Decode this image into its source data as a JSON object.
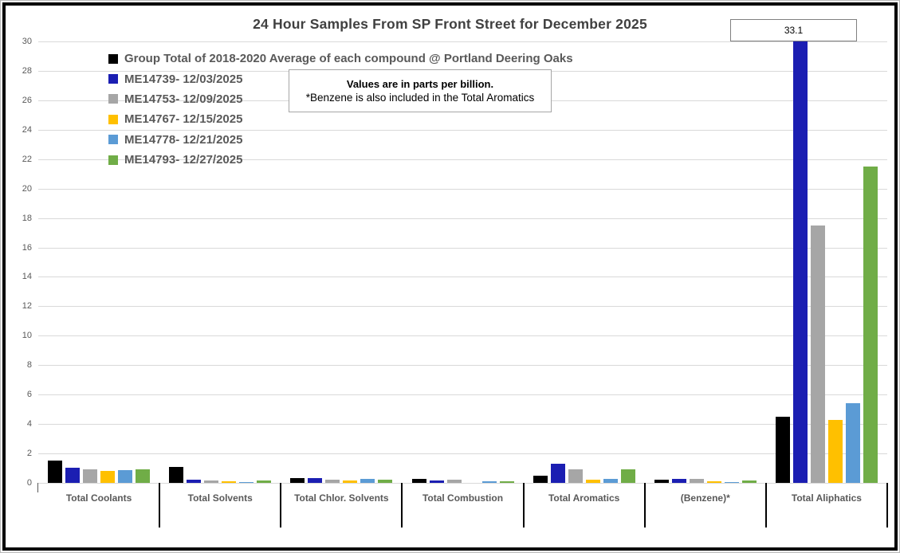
{
  "chart_data": {
    "type": "bar",
    "title": "24 Hour Samples From SP Front Street for December 2025",
    "values_note": {
      "line1": "Values are in parts per billion.",
      "line2": "*Benzene is also included in the Total Aromatics"
    },
    "categories": [
      "Total Coolants",
      "Total Solvents",
      "Total Chlor. Solvents",
      "Total Combustion",
      "Total Aromatics",
      "(Benzene)*",
      "Total Aliphatics"
    ],
    "series": [
      {
        "name": "Group Total of 2018-2020 Average of each compound @ Portland Deering Oaks",
        "color": "#000000",
        "values": [
          1.5,
          1.1,
          0.3,
          0.25,
          0.5,
          0.2,
          4.5
        ]
      },
      {
        "name": "ME14739- 12/03/2025",
        "color": "#1b1eb2",
        "values": [
          1.05,
          0.2,
          0.3,
          0.15,
          1.3,
          0.25,
          33.1
        ]
      },
      {
        "name": "ME14753- 12/09/2025",
        "color": "#a6a6a6",
        "values": [
          0.9,
          0.15,
          0.2,
          0.2,
          0.9,
          0.25,
          17.5
        ]
      },
      {
        "name": "ME14767- 12/15/2025",
        "color": "#ffc000",
        "values": [
          0.8,
          0.1,
          0.15,
          0.0,
          0.2,
          0.1,
          4.3
        ]
      },
      {
        "name": "ME14778- 12/21/2025",
        "color": "#5b9bd5",
        "values": [
          0.85,
          0.05,
          0.25,
          0.1,
          0.25,
          0.05,
          5.4
        ]
      },
      {
        "name": "ME14793- 12/27/2025",
        "color": "#70ad47",
        "values": [
          0.9,
          0.15,
          0.2,
          0.1,
          0.9,
          0.15,
          21.5
        ]
      }
    ],
    "ylim": [
      0,
      30
    ],
    "ytick_step": 2,
    "grid": true,
    "legend_position": "top-left",
    "annotation": {
      "label": "33.1",
      "series": "ME14739- 12/03/2025",
      "category": "Total Aliphatics",
      "note": "bar clipped at axis max 30"
    },
    "colors": {
      "gridline": "#d9d9d9",
      "axis_text": "#595959",
      "title_text": "#404040",
      "category_text": "#595959"
    }
  }
}
